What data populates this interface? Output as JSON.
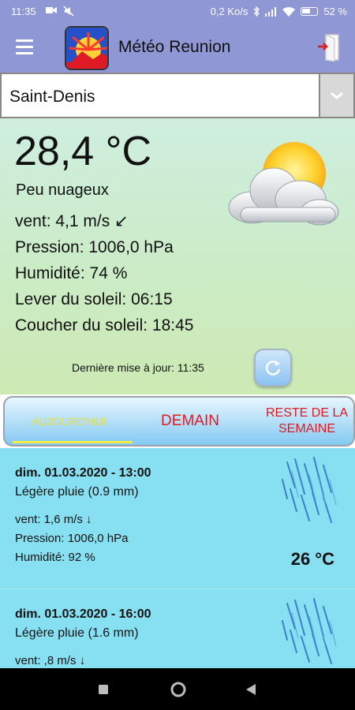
{
  "status_bar": {
    "time": "11:35",
    "network_speed": "0,2 Ko/s",
    "battery": "52 %"
  },
  "app_bar": {
    "title": "Météo Reunion",
    "menu_icon": "hamburger-menu-icon",
    "exit_icon": "exit-door-icon"
  },
  "location": {
    "selected": "Saint-Denis"
  },
  "current": {
    "temperature": "28,4 °C",
    "condition": "Peu nuageux",
    "wind": "vent: 4,1 m/s ↙",
    "pressure": "Pression: 1006,0 hPa",
    "humidity": "Humidité: 74 %",
    "sunrise": "Lever du soleil: 06:15",
    "sunset": "Coucher du soleil: 18:45",
    "last_update": "Dernière mise à jour: 11:35",
    "icon": "sun-behind-cloud-icon"
  },
  "tabs": [
    {
      "label": "AUJOURD'HUI",
      "active": true
    },
    {
      "label": "DEMAIN",
      "active": false
    },
    {
      "label": "RESTE DE LA SEMAINE",
      "active": false
    }
  ],
  "forecast": [
    {
      "datetime": "dim. 01.03.2020 - 13:00",
      "description": "Légère pluie (0.9 mm)",
      "wind": "vent: 1,6 m/s ↓",
      "pressure": "Pression: 1006,0 hPa",
      "humidity": "Humidité: 92 %",
      "temperature": "26 °C",
      "icon": "rain-icon"
    },
    {
      "datetime": "dim. 01.03.2020 - 16:00",
      "description": "Légère pluie (1.6 mm)",
      "wind": "vent: ,8 m/s ↓",
      "icon": "rain-icon"
    }
  ],
  "colors": {
    "app_bar": "#8f97d4",
    "forecast_bg": "#86e0f2",
    "tab_active": "#e5df3a",
    "tab_inactive": "#e01a24"
  }
}
